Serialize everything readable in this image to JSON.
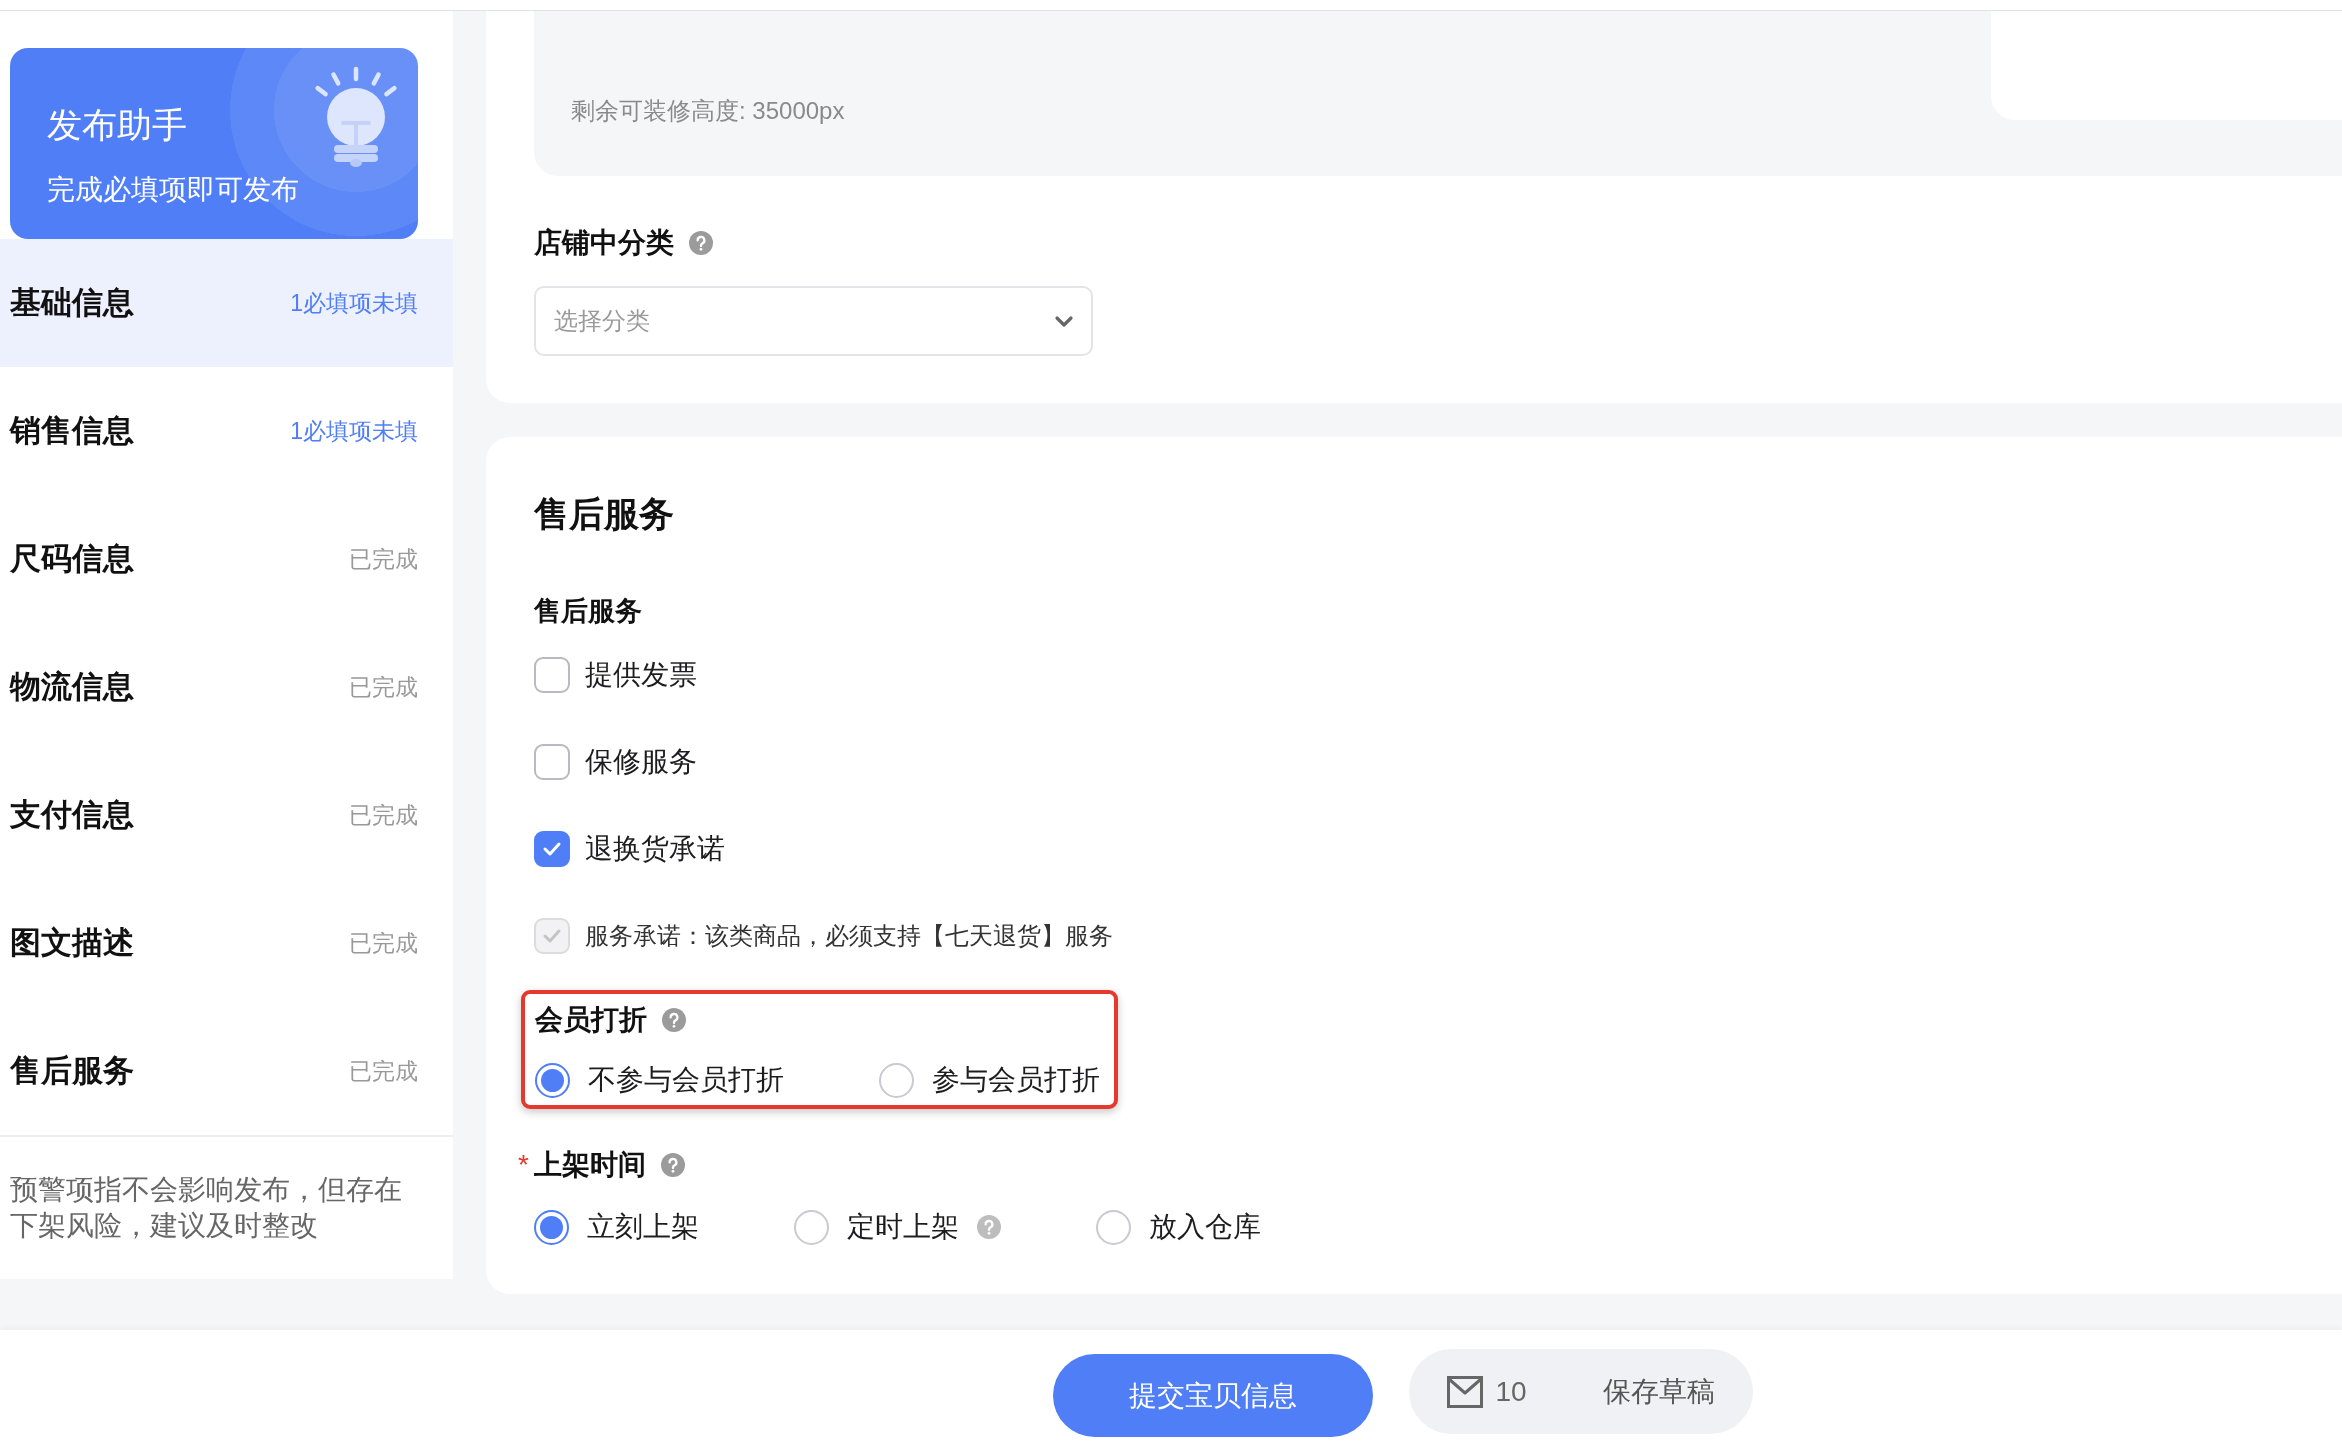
{
  "helper_card": {
    "title": "发布助手",
    "subtitle": "完成必填项即可发布"
  },
  "sidebar": {
    "items": [
      {
        "label": "基础信息",
        "status": "1必填项未填",
        "kind": "pending",
        "selected": true
      },
      {
        "label": "销售信息",
        "status": "1必填项未填",
        "kind": "pending",
        "selected": false
      },
      {
        "label": "尺码信息",
        "status": "已完成",
        "kind": "done",
        "selected": false
      },
      {
        "label": "物流信息",
        "status": "已完成",
        "kind": "done",
        "selected": false
      },
      {
        "label": "支付信息",
        "status": "已完成",
        "kind": "done",
        "selected": false
      },
      {
        "label": "图文描述",
        "status": "已完成",
        "kind": "done",
        "selected": false
      },
      {
        "label": "售后服务",
        "status": "已完成",
        "kind": "done",
        "selected": false
      }
    ],
    "note": "预警项指不会影响发布，但存在下架风险，建议及时整改"
  },
  "decoration": {
    "remaining_height": "剩余可装修高度: 35000px"
  },
  "shop_category": {
    "label": "店铺中分类",
    "has_help": true,
    "select": {
      "placeholder": "选择分类"
    }
  },
  "after_sales": {
    "title": "售后服务",
    "field_label": "售后服务",
    "options": [
      {
        "label": "提供发票",
        "kind": "option",
        "checked": false,
        "disabled": false
      },
      {
        "label": "保修服务",
        "kind": "option",
        "checked": false,
        "disabled": false
      },
      {
        "label": "退换货承诺",
        "kind": "option",
        "checked": true,
        "disabled": false
      },
      {
        "label": "服务承诺：该类商品，必须支持【七天退货】服务",
        "kind": "notice",
        "checked": true,
        "disabled": true
      }
    ]
  },
  "member_discount": {
    "label": "会员打折",
    "has_help": true,
    "highlighted": true,
    "options": [
      {
        "label": "不参与会员打折",
        "selected": true
      },
      {
        "label": "参与会员打折",
        "selected": false
      }
    ]
  },
  "listing_time": {
    "label": "上架时间",
    "required_mark": "*",
    "has_help": true,
    "options": [
      {
        "label": "立刻上架",
        "selected": true
      },
      {
        "label": "定时上架",
        "selected": false,
        "has_help": true
      },
      {
        "label": "放入仓库",
        "selected": false
      }
    ]
  },
  "footer": {
    "submit_button": "提交宝贝信息",
    "message_count": "10",
    "save_draft_button": "保存草稿"
  }
}
